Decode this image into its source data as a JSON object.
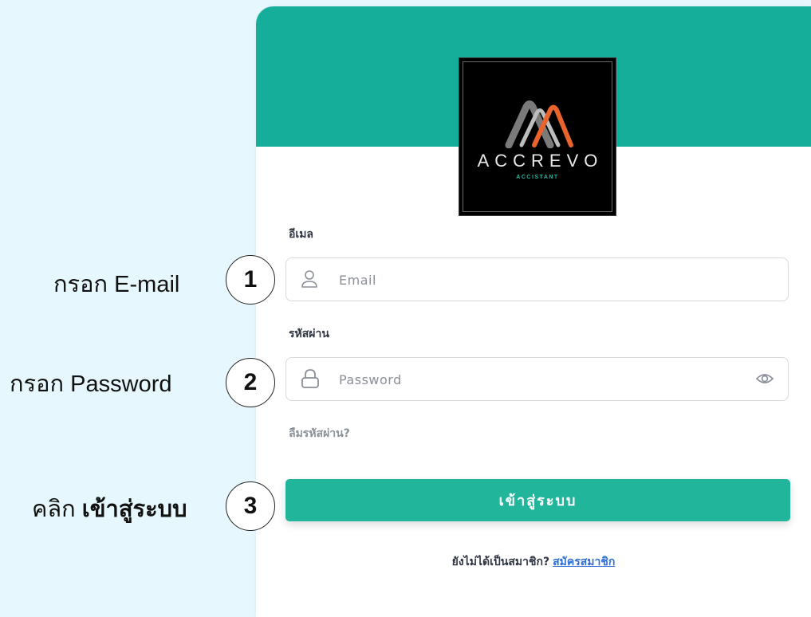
{
  "logo": {
    "name": "ACCREVO",
    "subtitle": "ACCISTANT"
  },
  "form": {
    "email_label": "อีเมล",
    "email_placeholder": "Email",
    "email_value": "",
    "password_label": "รหัสผ่าน",
    "password_placeholder": "Password",
    "password_value": "",
    "forgot_link": "ลืมรหัสผ่าน?",
    "submit_label": "เข้าสู่ระบบ",
    "signup_prompt": "ยังไม่ได้เป็นสมาชิก?",
    "signup_link": "สมัครสมาชิก"
  },
  "annotations": [
    {
      "step": "1",
      "text": "กรอก E-mail"
    },
    {
      "step": "2",
      "text": "กรอก Password"
    },
    {
      "step": "3",
      "prefix": "คลิก ",
      "bold": "เข้าสู่ระบบ"
    }
  ],
  "icons": {
    "email": "user-icon",
    "password": "lock-icon",
    "toggle": "eye-icon"
  },
  "colors": {
    "page_bg": "#e6f8fd",
    "header": "#14ae9a",
    "button": "#21b59c",
    "link": "#2f6fd3",
    "logo_accent": "#e8642c"
  }
}
